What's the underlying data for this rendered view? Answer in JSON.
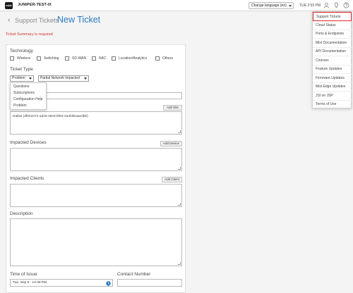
{
  "topbar": {
    "org_name": "JUNIPER-TEST-IX",
    "language_select": "Change language (en)",
    "time": "TUE 2:55 PM",
    "icons": [
      "user-icon",
      "lightbulb-icon",
      "help-icon"
    ]
  },
  "header": {
    "breadcrumb": "Support Tickets",
    "separator": ":",
    "title": "New Ticket",
    "error": "Ticket Summary is required"
  },
  "form": {
    "technology_label": "Technology",
    "technologies": [
      "Wireless",
      "Switching",
      "SD-WAN",
      "NAC",
      "Location/Analytics",
      "Others"
    ],
    "ticket_type_label": "Ticket Type",
    "ticket_type_value": "Problem",
    "ticket_type_options": [
      "Questions",
      "Subscriptions",
      "Configuration Help",
      "Problem"
    ],
    "priority_value": "Partial Network Impacted",
    "add_site_label": "Add Site",
    "site_value": "Dallas (df043472-ad16-48c6-bf64-2a4b0baaedb9)",
    "impacted_devices_label": "Impacted Devices",
    "add_device_label": "Add Device",
    "impacted_clients_label": "Impacted Clients",
    "add_client_label": "Add Client",
    "description_label": "Description",
    "time_of_issue_label": "Time of Issue",
    "time_of_issue_value": "Tue, Sep 5 - 12:49 PM",
    "contact_number_label": "Contact Number"
  },
  "help_menu": {
    "items": [
      "Support Tickets",
      "Cloud Status",
      "Ports & Endpoints",
      "Mist Documentation",
      "API Documentation",
      "Courses",
      "Feature Updates",
      "Firmware Updates",
      "Mist Edge Updates",
      "JSI on JSP",
      "Terms of Use"
    ],
    "active": "Support Tickets"
  },
  "colors": {
    "accent": "#2a7bbf",
    "error": "#d0342c",
    "highlight": "#d9282f"
  }
}
